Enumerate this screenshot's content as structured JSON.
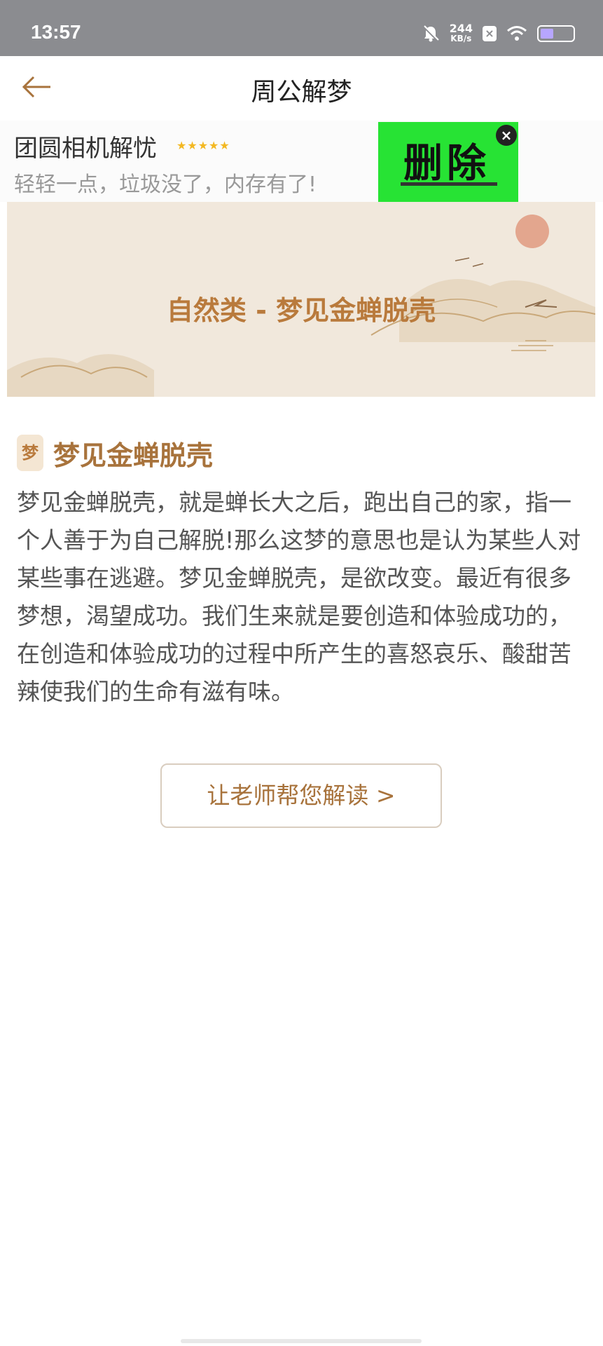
{
  "status": {
    "time": "13:57",
    "speed_value": "244",
    "speed_unit": "KB/s"
  },
  "header": {
    "title": "周公解梦",
    "back_icon": "back-arrow-icon"
  },
  "ad": {
    "title": "团圆相机解忧",
    "stars": "★★★★★",
    "subtitle": "轻轻一点，垃圾没了，内存有了!",
    "image_text": "删除",
    "close_icon": "close-icon",
    "colors": {
      "image_bg": "#27e334",
      "star": "#f3b822"
    }
  },
  "banner": {
    "title": "自然类 - 梦见金蝉脱壳"
  },
  "article": {
    "icon_char": "梦",
    "title": "梦见金蝉脱壳",
    "body": "梦见金蝉脱壳，就是蝉长大之后，跑出自己的家，指一个人善于为自己解脱!那么这梦的意思也是认为某些人对某些事在逃避。梦见金蝉脱壳，是欲改变。最近有很多梦想，渴望成功。我们生来就是要创造和体验成功的，在创造和体验成功的过程中所产生的喜怒哀乐、酸甜苦辣使我们的生命有滋有味。",
    "button_label": "让老师帮您解读 >"
  },
  "colors": {
    "accent": "#a8733c",
    "status_bar": "#8b8c90"
  }
}
